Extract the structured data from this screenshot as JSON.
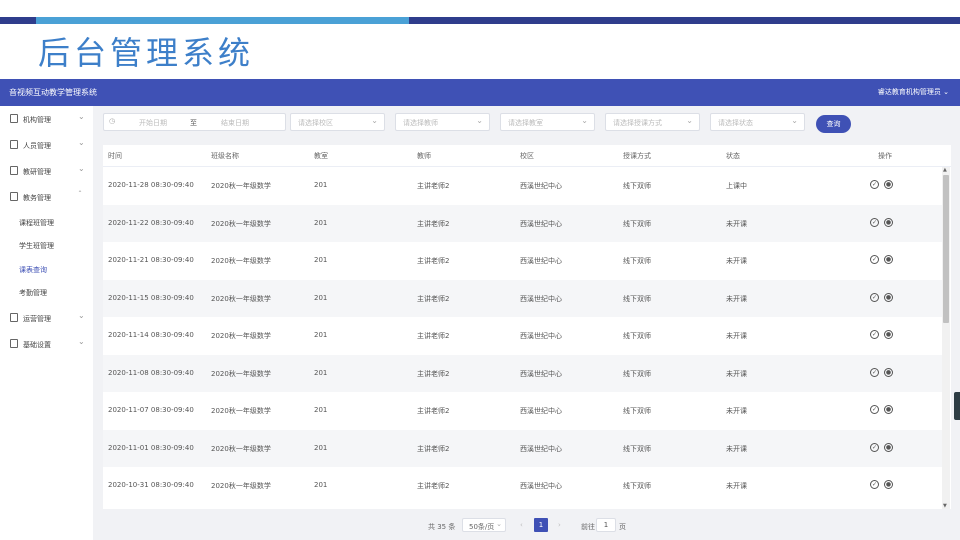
{
  "slide_title": "后台管理系统",
  "header": {
    "app_name": "音视频互动教学管理系统",
    "user": "睿达教育机构管理员 ⌄"
  },
  "sidebar": {
    "items": [
      {
        "label": "机构管理",
        "icon": "home-icon"
      },
      {
        "label": "人员管理",
        "icon": "doc-icon"
      },
      {
        "label": "教研管理",
        "icon": "doc-icon"
      },
      {
        "label": "教务管理",
        "icon": "doc-icon"
      },
      {
        "label": "运营管理",
        "icon": "doc-icon"
      },
      {
        "label": "基础设置",
        "icon": "doc-icon"
      }
    ],
    "sub_items": [
      "课程班管理",
      "学生班管理",
      "课表查询",
      "考勤管理"
    ],
    "active_sub": "课表查询"
  },
  "filters": {
    "start_date": "开始日期",
    "to": "至",
    "end_date": "结束日期",
    "campus": "请选择校区",
    "teacher": "请选择教师",
    "classroom": "请选择教室",
    "mode": "请选择授课方式",
    "status": "请选择状态",
    "query": "查询"
  },
  "table": {
    "headers": [
      "时间",
      "班级名称",
      "教室",
      "教师",
      "校区",
      "授课方式",
      "状态",
      "操作"
    ],
    "rows": [
      [
        "2020-11-28 08:30-09:40",
        "2020秋一年级数学",
        "201",
        "主讲老师2",
        "西溪世纪中心",
        "线下双师",
        "上课中"
      ],
      [
        "2020-11-22 08:30-09:40",
        "2020秋一年级数学",
        "201",
        "主讲老师2",
        "西溪世纪中心",
        "线下双师",
        "未开课"
      ],
      [
        "2020-11-21 08:30-09:40",
        "2020秋一年级数学",
        "201",
        "主讲老师2",
        "西溪世纪中心",
        "线下双师",
        "未开课"
      ],
      [
        "2020-11-15 08:30-09:40",
        "2020秋一年级数学",
        "201",
        "主讲老师2",
        "西溪世纪中心",
        "线下双师",
        "未开课"
      ],
      [
        "2020-11-14 08:30-09:40",
        "2020秋一年级数学",
        "201",
        "主讲老师2",
        "西溪世纪中心",
        "线下双师",
        "未开课"
      ],
      [
        "2020-11-08 08:30-09:40",
        "2020秋一年级数学",
        "201",
        "主讲老师2",
        "西溪世纪中心",
        "线下双师",
        "未开课"
      ],
      [
        "2020-11-07 08:30-09:40",
        "2020秋一年级数学",
        "201",
        "主讲老师2",
        "西溪世纪中心",
        "线下双师",
        "未开课"
      ],
      [
        "2020-11-01 08:30-09:40",
        "2020秋一年级数学",
        "201",
        "主讲老师2",
        "西溪世纪中心",
        "线下双师",
        "未开课"
      ],
      [
        "2020-10-31 08:30-09:40",
        "2020秋一年级数学",
        "201",
        "主讲老师2",
        "西溪世纪中心",
        "线下双师",
        "未开课"
      ]
    ]
  },
  "pagination": {
    "total": "共 35 条",
    "page_size": "50条/页",
    "current_page": "1",
    "goto": "前往",
    "goto_value": "1",
    "page_unit": "页"
  },
  "colors": {
    "primary": "#3f51b5",
    "bar_light": "#4aa1d6",
    "bar_dark": "#2f3d8c",
    "title": "#3d7fc9"
  }
}
